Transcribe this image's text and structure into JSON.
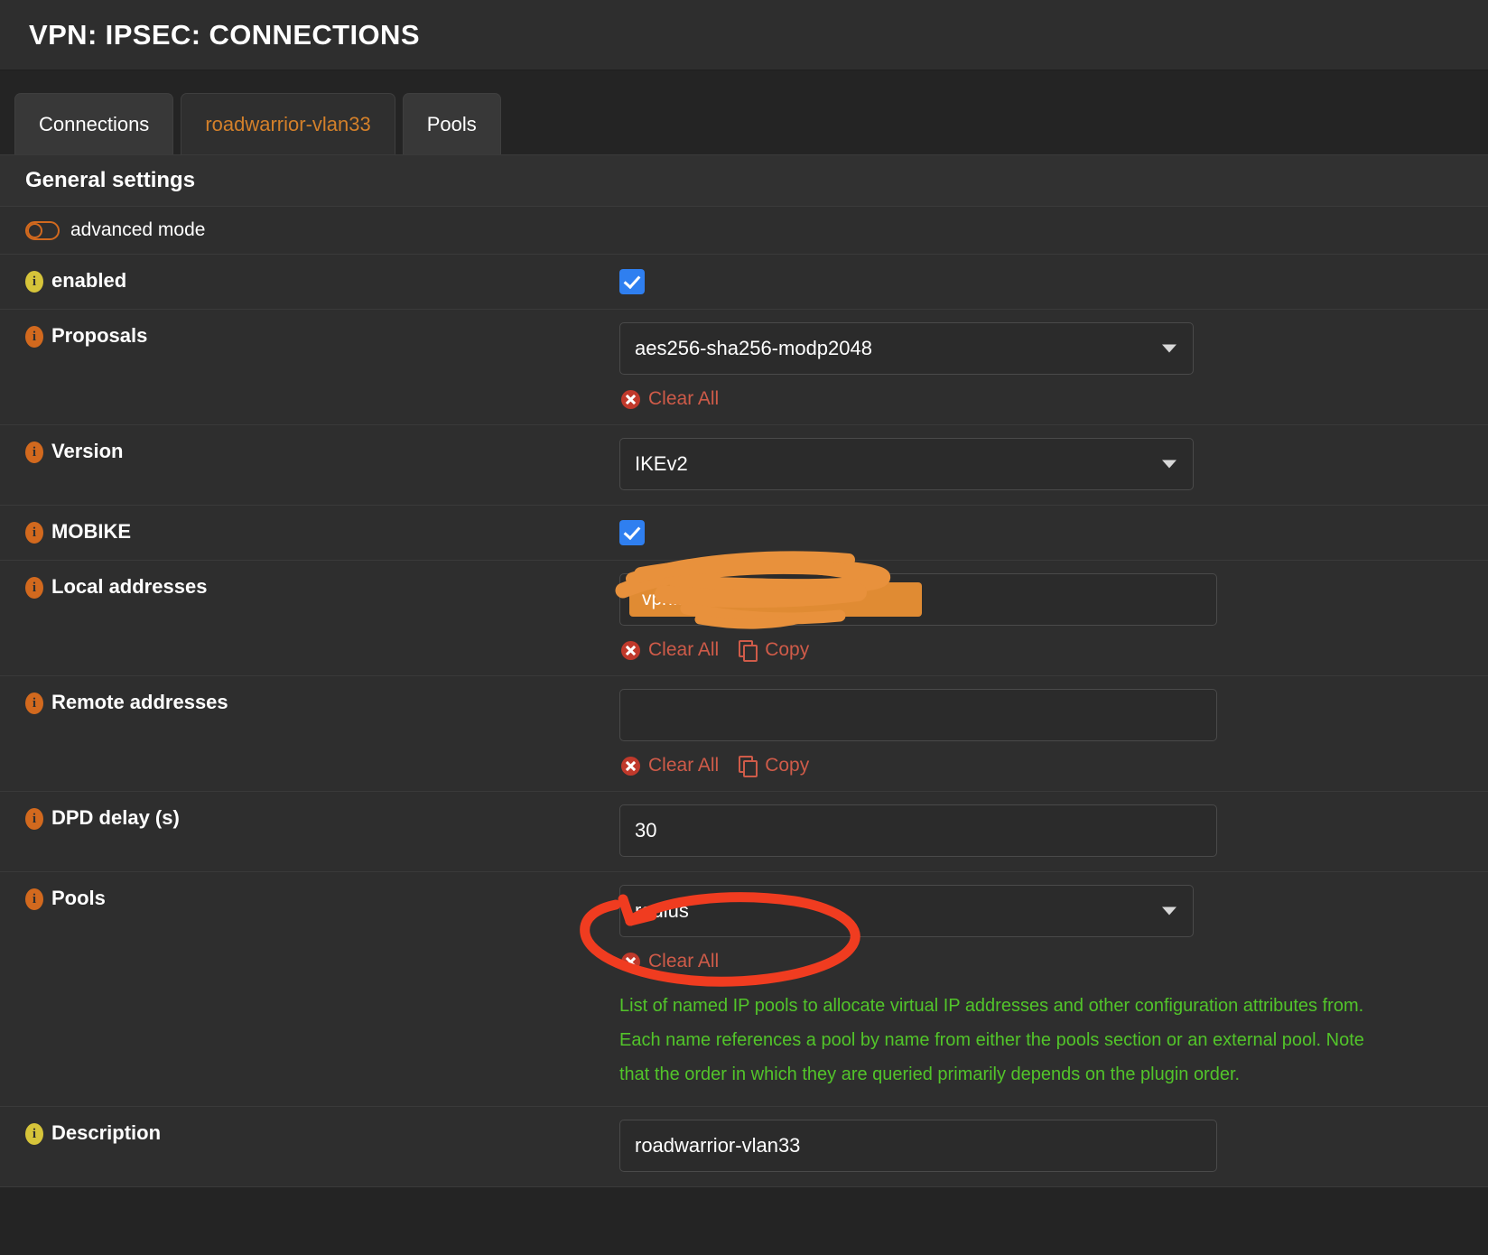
{
  "header": {
    "title": "VPN: IPSEC: CONNECTIONS"
  },
  "tabs": [
    {
      "label": "Connections",
      "state": "active"
    },
    {
      "label": "roadwarrior-vlan33",
      "state": "link"
    },
    {
      "label": "Pools",
      "state": "normal"
    }
  ],
  "section": {
    "title": "General settings"
  },
  "advanced_mode": {
    "label": "advanced mode",
    "enabled": false
  },
  "fields": {
    "enabled": {
      "label": "enabled",
      "checked": true,
      "icon": "info-icon-yellow"
    },
    "proposals": {
      "label": "Proposals",
      "value": "aes256-sha256-modp2048",
      "icon": "info-icon-orange",
      "clear_all": "Clear All"
    },
    "version": {
      "label": "Version",
      "value": "IKEv2",
      "icon": "info-icon-orange"
    },
    "mobike": {
      "label": "MOBIKE",
      "checked": true,
      "icon": "info-icon-orange"
    },
    "local_addresses": {
      "label": "Local addresses",
      "tag_value": "vpn...                       at",
      "tag_remove": "×",
      "icon": "info-icon-orange",
      "clear_all": "Clear All",
      "copy": "Copy",
      "redacted": true
    },
    "remote_addresses": {
      "label": "Remote addresses",
      "value": "",
      "icon": "info-icon-orange",
      "clear_all": "Clear All",
      "copy": "Copy"
    },
    "dpd_delay": {
      "label": "DPD delay (s)",
      "value": "30",
      "icon": "info-icon-orange"
    },
    "pools": {
      "label": "Pools",
      "value": "radius",
      "icon": "info-icon-orange",
      "clear_all": "Clear All",
      "help": "List of named IP pools to allocate virtual IP addresses and other configuration attributes from. Each name references a pool by name from either the pools section or an external pool. Note that the order in which they are queried primarily depends on the plugin order."
    },
    "description": {
      "label": "Description",
      "value": "roadwarrior-vlan33",
      "icon": "info-icon-yellow"
    }
  },
  "annotations": {
    "scribble": {
      "type": "marker-scribble",
      "color": "#e8913c",
      "target": "local-addresses-value"
    },
    "highlight_circle": {
      "type": "hand-drawn-circle",
      "color": "#f03c20",
      "target": "pools-select"
    }
  },
  "colors": {
    "accent_orange": "#d2691e",
    "link_red": "#cf5b49",
    "help_green": "#52c42a",
    "checkbox_blue": "#2f7ff0",
    "tag_orange": "#e08b33",
    "annotation_red": "#f03c20",
    "annotation_orange": "#e8913c"
  }
}
